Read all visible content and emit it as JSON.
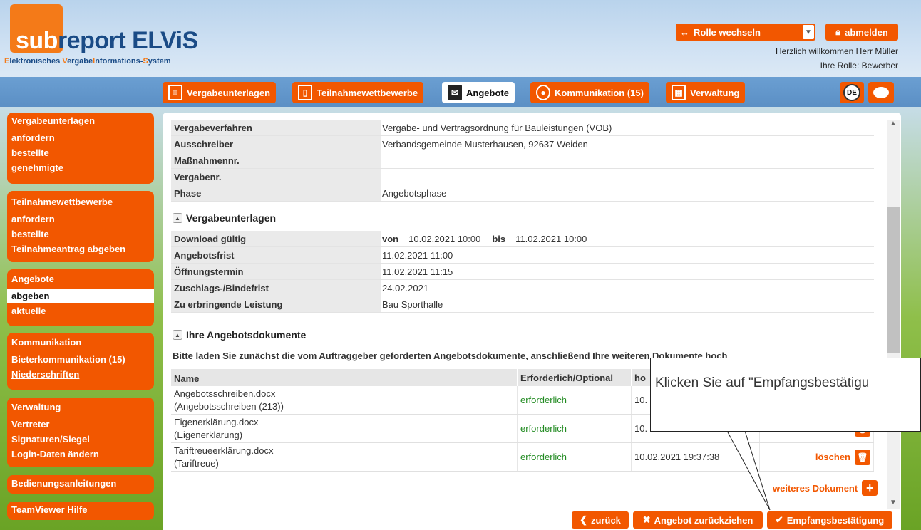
{
  "app": {
    "logo_part1": "sub",
    "logo_part2": "report ELViS",
    "subtitle_E": "E",
    "subtitle_1": "lektronisches ",
    "subtitle_V": "V",
    "subtitle_2": "ergabe",
    "subtitle_I": "I",
    "subtitle_3": "nformations-",
    "subtitle_S": "S",
    "subtitle_4": "ystem"
  },
  "header": {
    "role_switch_label": "Rolle wechseln",
    "logout_label": "abmelden",
    "welcome": "Herzlich willkommen Herr Müller",
    "role_line": "Ihre Rolle: Bewerber"
  },
  "nav": {
    "tabs": [
      {
        "label": "Vergabeunterlagen",
        "icon": "document-icon"
      },
      {
        "label": "Teilnahmewettbewerbe",
        "icon": "form-icon"
      },
      {
        "label": "Angebote",
        "icon": "envelope-icon"
      },
      {
        "label": "Kommunikation (15)",
        "icon": "chat-user-icon"
      },
      {
        "label": "Verwaltung",
        "icon": "grid-icon"
      }
    ],
    "lang": "DE"
  },
  "sidebar": [
    {
      "title": "Vergabeunterlagen",
      "items": [
        "anfordern",
        "bestellte",
        "genehmigte"
      ]
    },
    {
      "title": "Teilnahmewettbewerbe",
      "items": [
        "anfordern",
        "bestellte",
        "Teilnahmeantrag abgeben"
      ]
    },
    {
      "title": "Angebote",
      "items": [
        "abgeben",
        "aktuelle"
      ]
    },
    {
      "title": "Kommunikation",
      "items": [
        "Bieterkommunikation (15)",
        "Niederschriften"
      ]
    },
    {
      "title": "Verwaltung",
      "items": [
        "Vertreter",
        "Signaturen/Siegel",
        "Login-Daten ändern"
      ]
    },
    {
      "title": "Bedienungsanleitungen",
      "items": []
    },
    {
      "title": "TeamViewer Hilfe",
      "items": []
    }
  ],
  "info": [
    {
      "k": "Vergabeverfahren",
      "v": "Vergabe- und Vertragsordnung für Bauleistungen (VOB)"
    },
    {
      "k": "Ausschreiber",
      "v": "Verbandsgemeinde Musterhausen, 92637 Weiden"
    },
    {
      "k": "Maßnahmennr.",
      "v": ""
    },
    {
      "k": "Vergabenr.",
      "v": ""
    },
    {
      "k": "Phase",
      "v": "Angebotsphase"
    }
  ],
  "vergabe_section": {
    "title": "Vergabeunterlagen",
    "download_label": "Download gültig",
    "von": "von",
    "from": "10.02.2021 10:00",
    "bis": "bis",
    "to": "11.02.2021 10:00",
    "rows": [
      {
        "k": "Angebotsfrist",
        "v": "11.02.2021 11:00"
      },
      {
        "k": "Öffnungstermin",
        "v": "11.02.2021 11:15"
      },
      {
        "k": "Zuschlags-/Bindefrist",
        "v": "24.02.2021"
      },
      {
        "k": "Zu erbringende Leistung",
        "v": "Bau Sporthalle"
      }
    ]
  },
  "docs_section": {
    "title": "Ihre Angebotsdokumente",
    "hint": "Bitte laden Sie zunächst die vom Auftraggeber geforderten Angebotsdokumente, anschließend Ihre weiteren Dokumente hoch.",
    "columns": [
      "Name",
      "Erforderlich/Optional",
      "ho",
      ""
    ],
    "rows": [
      {
        "name": "Angebotsschreiben.docx",
        "sub": "(Angebotsschreiben (213))",
        "req": "erforderlich",
        "date": "10.",
        "action": ""
      },
      {
        "name": "Eigenerklärung.docx",
        "sub": "(Eigenerklärung)",
        "req": "erforderlich",
        "date": "10.",
        "action": ""
      },
      {
        "name": "Tariftreueerklärung.docx",
        "sub": "(Tariftreue)",
        "req": "erforderlich",
        "date": "10.02.2021 19:37:38",
        "action": "löschen"
      }
    ],
    "add_label": "weiteres Dokument"
  },
  "actions": {
    "back": "zurück",
    "withdraw": "Angebot zurückziehen",
    "receipt": "Empfangsbestätigung"
  },
  "callout": {
    "text": "Klicken Sie auf \"Empfangsbestätigu"
  },
  "colors": {
    "accent": "#f25700",
    "nav_blue": "#5b8fc5"
  }
}
